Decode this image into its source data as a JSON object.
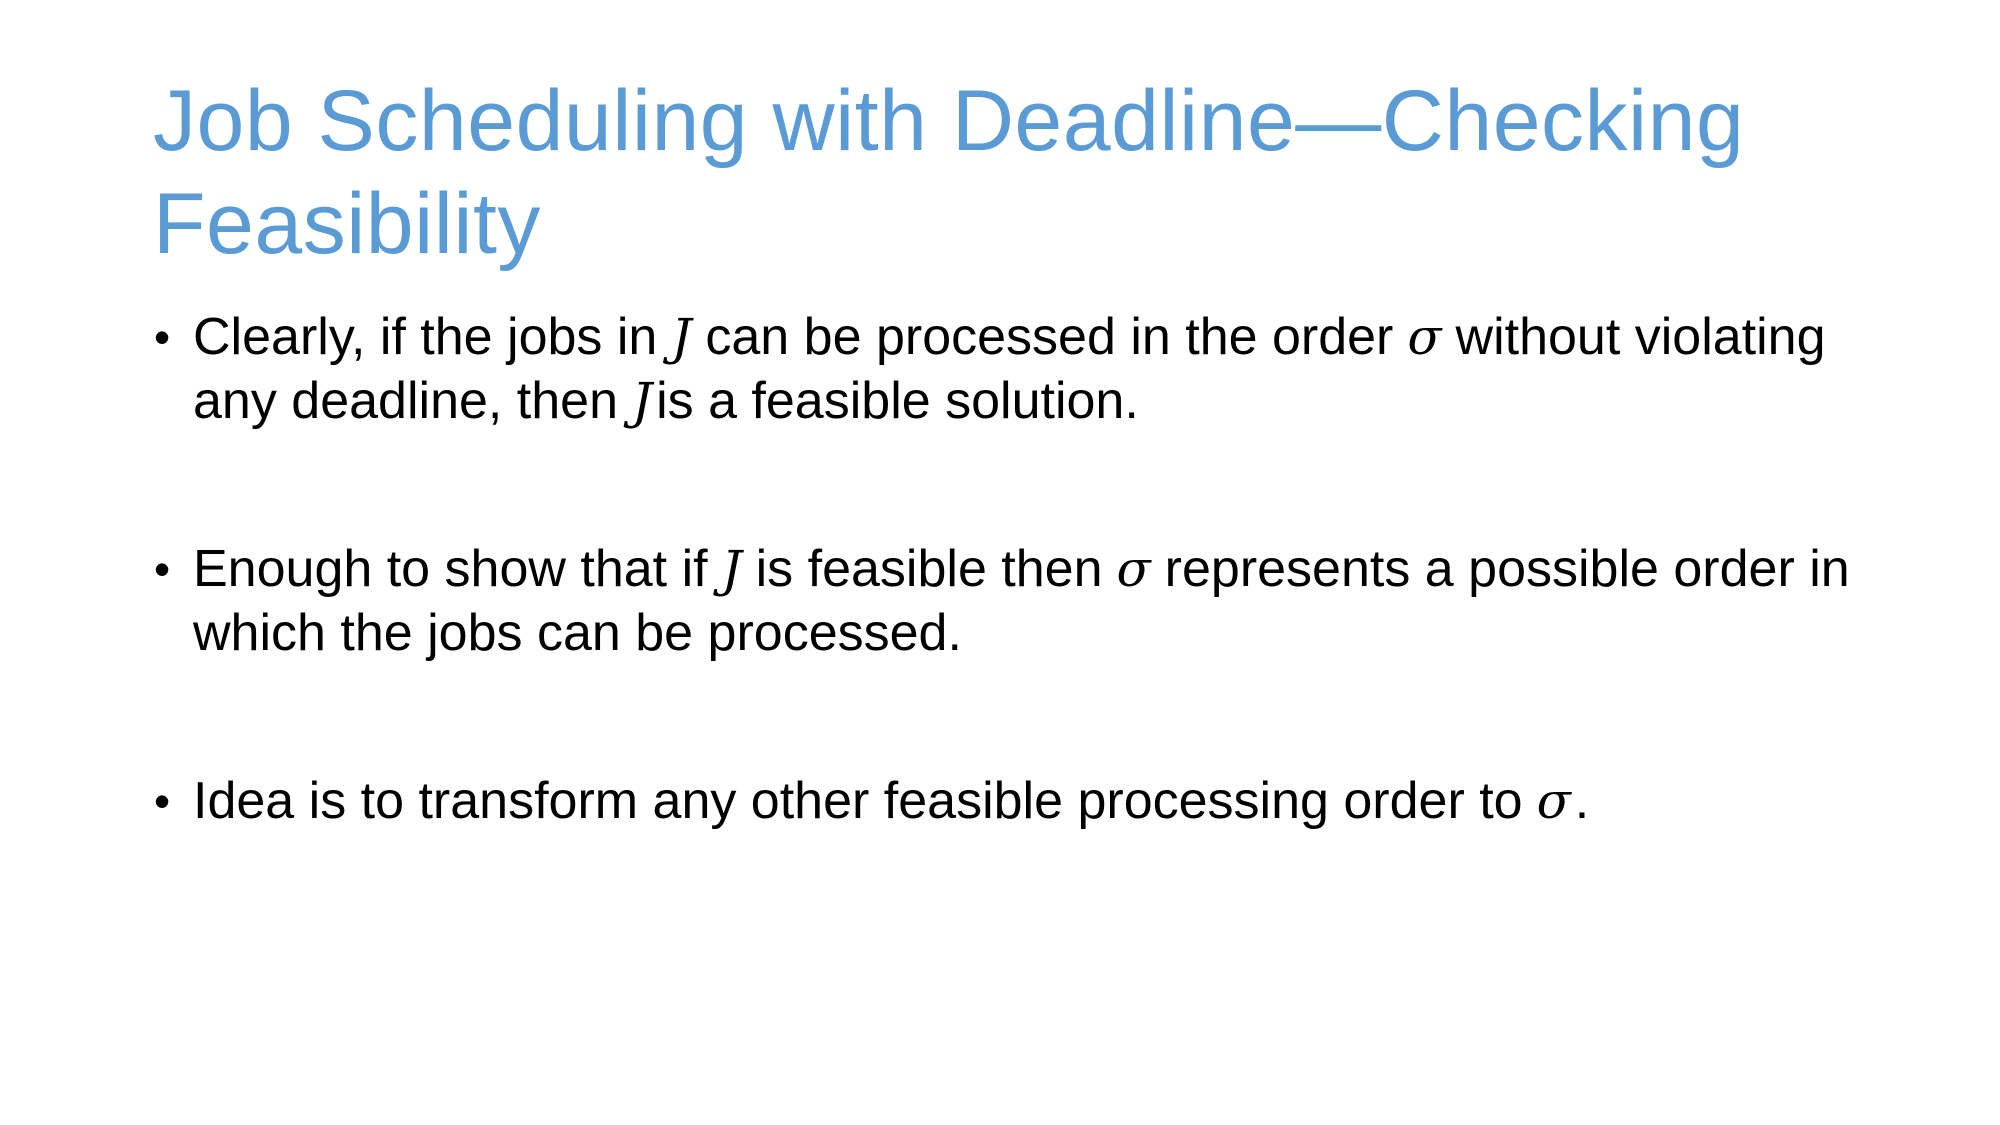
{
  "slide": {
    "title": "Job Scheduling with Deadline—Checking Feasibility",
    "title_color": "#5b9bd5",
    "bullet_symbol": "•",
    "bullets": [
      {
        "parts": [
          "Clearly, if the jobs in",
          "J",
          "can be processed in the order",
          "σ",
          "without violating any deadline, then",
          "J",
          "is a feasible solution."
        ]
      },
      {
        "parts": [
          "Enough to show that if",
          "J",
          "is feasible then",
          "σ",
          "represents a possible order in which the jobs can be processed."
        ]
      },
      {
        "parts": [
          "Idea is to transform any other feasible processing order to",
          "σ",
          "."
        ]
      }
    ]
  }
}
